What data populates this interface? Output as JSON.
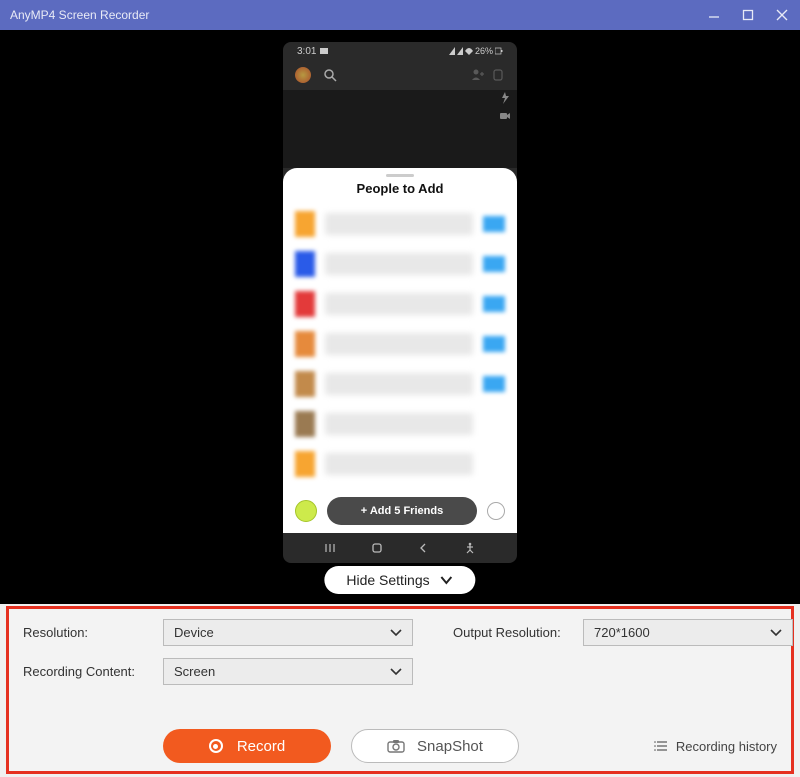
{
  "app": {
    "title": "AnyMP4 Screen Recorder"
  },
  "phone": {
    "status_time": "3:01",
    "status_battery": "26%",
    "sheet_title": "People to Add",
    "add_friends_label": "+ Add 5 Friends",
    "people": [
      {
        "avatar_color": "#f7a531",
        "badge_color": "#3aa7f2"
      },
      {
        "avatar_color": "#2a5be8",
        "badge_color": "#3aa7f2"
      },
      {
        "avatar_color": "#e33a3a",
        "badge_color": "#3aa7f2"
      },
      {
        "avatar_color": "#e68a3c",
        "badge_color": "#3aa7f2"
      },
      {
        "avatar_color": "#c28a4b",
        "badge_color": "#3aa7f2"
      },
      {
        "avatar_color": "#9a7a52",
        "badge_color": "#ffffff"
      },
      {
        "avatar_color": "#f7a531",
        "badge_color": "#ffffff"
      }
    ]
  },
  "hide_settings_label": "Hide Settings",
  "settings": {
    "resolution_label": "Resolution:",
    "resolution_value": "Device",
    "output_label": "Output Resolution:",
    "output_value": "720*1600",
    "content_label": "Recording Content:",
    "content_value": "Screen"
  },
  "actions": {
    "record_label": "Record",
    "snapshot_label": "SnapShot",
    "history_label": "Recording history"
  }
}
